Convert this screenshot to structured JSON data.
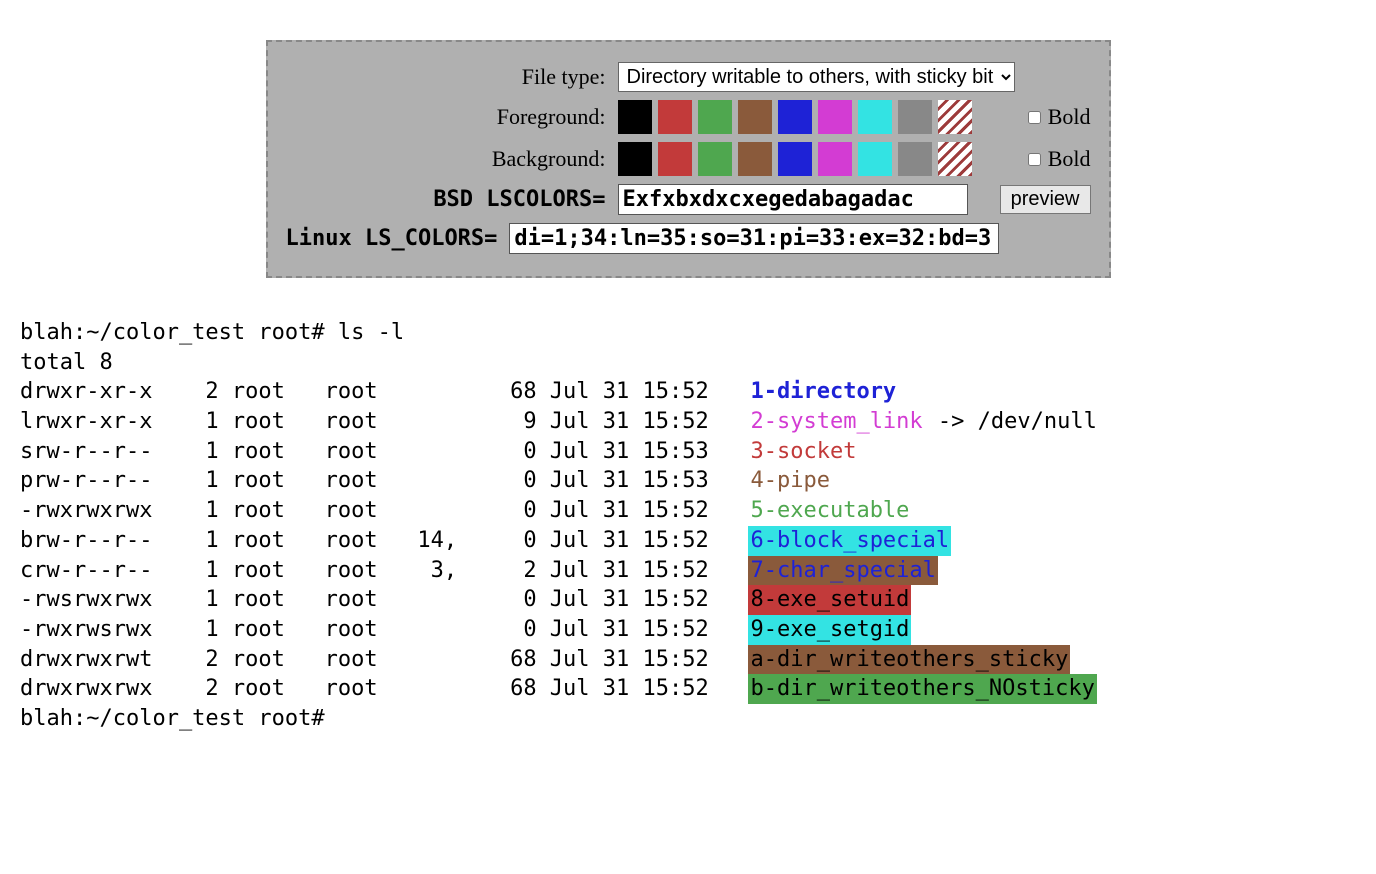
{
  "panel": {
    "file_type_label": "File type:",
    "file_type_value": "Directory writable to others, with sticky bit",
    "foreground_label": "Foreground:",
    "background_label": "Background:",
    "bold_label": "Bold",
    "bsd_label": "BSD LSCOLORS=",
    "bsd_value": "Exfxbxdxcxegedabagadac",
    "linux_label": "Linux LS_COLORS=",
    "linux_value": "di=1;34:ln=35:so=31:pi=33:ex=32:bd=3",
    "preview_label": "preview",
    "swatches": [
      "#000000",
      "#c23a3a",
      "#4fa74f",
      "#8a5a3b",
      "#1e22d6",
      "#d33cd3",
      "#33e3e3",
      "#888888"
    ]
  },
  "terminal": {
    "prompt1": "blah:~/color_test root# ls -l",
    "total": "total 8",
    "prompt2": "blah:~/color_test root#",
    "rows": [
      {
        "perm": "drwxr-xr-x",
        "links": "2",
        "owner": "root",
        "group": "root",
        "maj": "",
        "size": "68",
        "date": "Jul 31 15:52",
        "name": "1-directory",
        "fg": "#1e22d6",
        "bg": "",
        "bold": true,
        "suffix": ""
      },
      {
        "perm": "lrwxr-xr-x",
        "links": "1",
        "owner": "root",
        "group": "root",
        "maj": "",
        "size": "9",
        "date": "Jul 31 15:52",
        "name": "2-system_link",
        "fg": "#d33cd3",
        "bg": "",
        "bold": false,
        "suffix": " -> /dev/null"
      },
      {
        "perm": "srw-r--r--",
        "links": "1",
        "owner": "root",
        "group": "root",
        "maj": "",
        "size": "0",
        "date": "Jul 31 15:53",
        "name": "3-socket",
        "fg": "#c23a3a",
        "bg": "",
        "bold": false,
        "suffix": ""
      },
      {
        "perm": "prw-r--r--",
        "links": "1",
        "owner": "root",
        "group": "root",
        "maj": "",
        "size": "0",
        "date": "Jul 31 15:53",
        "name": "4-pipe",
        "fg": "#8a5a3b",
        "bg": "",
        "bold": false,
        "suffix": ""
      },
      {
        "perm": "-rwxrwxrwx",
        "links": "1",
        "owner": "root",
        "group": "root",
        "maj": "",
        "size": "0",
        "date": "Jul 31 15:52",
        "name": "5-executable",
        "fg": "#4fa74f",
        "bg": "",
        "bold": false,
        "suffix": ""
      },
      {
        "perm": "brw-r--r--",
        "links": "1",
        "owner": "root",
        "group": "root",
        "maj": "14,",
        "size": "0",
        "date": "Jul 31 15:52",
        "name": "6-block_special",
        "fg": "#1e22d6",
        "bg": "#33e3e3",
        "bold": false,
        "suffix": ""
      },
      {
        "perm": "crw-r--r--",
        "links": "1",
        "owner": "root",
        "group": "root",
        "maj": "3,",
        "size": "2",
        "date": "Jul 31 15:52",
        "name": "7-char_special",
        "fg": "#1e22d6",
        "bg": "#8a5a3b",
        "bold": false,
        "suffix": ""
      },
      {
        "perm": "-rwsrwxrwx",
        "links": "1",
        "owner": "root",
        "group": "root",
        "maj": "",
        "size": "0",
        "date": "Jul 31 15:52",
        "name": "8-exe_setuid",
        "fg": "#000000",
        "bg": "#c23a3a",
        "bold": false,
        "suffix": ""
      },
      {
        "perm": "-rwxrwsrwx",
        "links": "1",
        "owner": "root",
        "group": "root",
        "maj": "",
        "size": "0",
        "date": "Jul 31 15:52",
        "name": "9-exe_setgid",
        "fg": "#000000",
        "bg": "#33e3e3",
        "bold": false,
        "suffix": ""
      },
      {
        "perm": "drwxrwxrwt",
        "links": "2",
        "owner": "root",
        "group": "root",
        "maj": "",
        "size": "68",
        "date": "Jul 31 15:52",
        "name": "a-dir_writeothers_sticky",
        "fg": "#000000",
        "bg": "#8a5a3b",
        "bold": false,
        "suffix": ""
      },
      {
        "perm": "drwxrwxrwx",
        "links": "2",
        "owner": "root",
        "group": "root",
        "maj": "",
        "size": "68",
        "date": "Jul 31 15:52",
        "name": "b-dir_writeothers_NOsticky",
        "fg": "#000000",
        "bg": "#4fa74f",
        "bold": false,
        "suffix": ""
      }
    ]
  }
}
